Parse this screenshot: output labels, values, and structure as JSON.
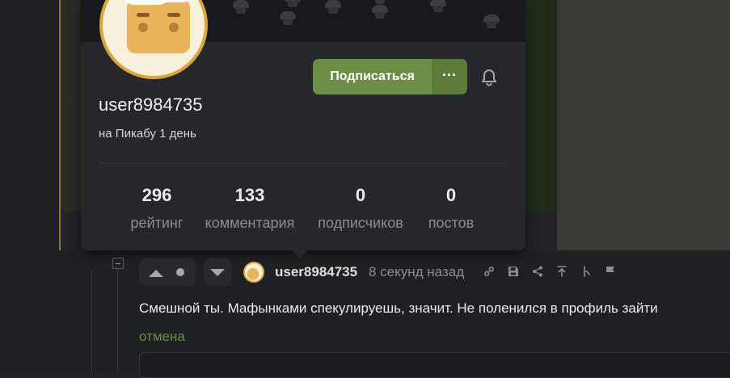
{
  "profile_popup": {
    "username": "user8984735",
    "since": "на Пикабу 1 день",
    "subscribe_label": "Подписаться",
    "more_label": "···",
    "stats": [
      {
        "value": "296",
        "label": "рейтинг"
      },
      {
        "value": "133",
        "label": "комментария"
      },
      {
        "value": "0",
        "label": "подписчиков"
      },
      {
        "value": "0",
        "label": "постов"
      }
    ]
  },
  "comment": {
    "username": "user8984735",
    "time": "8 секунд назад",
    "text": "Смешной ты. Мафынками спекулируешь, значит. Не поленился в профиль зайти",
    "cancel_label": "отмена"
  },
  "colors": {
    "accent": "#6b8d45",
    "background": "#222327",
    "popup": "#26272b"
  },
  "icons": [
    "bell-icon",
    "link-icon",
    "save-icon",
    "share-icon",
    "upload-icon",
    "branch-icon",
    "flag-icon",
    "collapse-icon"
  ]
}
